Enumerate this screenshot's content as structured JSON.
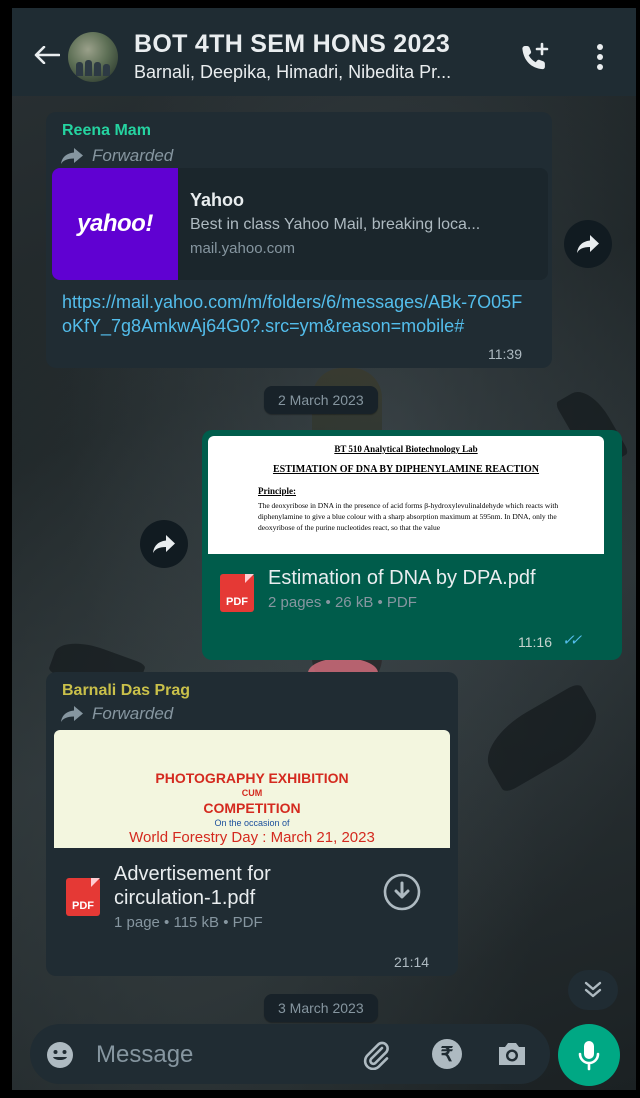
{
  "header": {
    "title": "BOT 4TH SEM HONS 2023",
    "members": "Barnali, Deepika, Himadri, Nibedita Pr..."
  },
  "messages": {
    "m1": {
      "sender": "Reena Mam",
      "sender_color": "#25d3a0",
      "forwarded": "Forwarded",
      "preview_logo": "yahoo!",
      "preview_title": "Yahoo",
      "preview_desc": "Best in class Yahoo Mail, breaking loca...",
      "preview_domain": "mail.yahoo.com",
      "link": "https://mail.yahoo.com/m/folders/6/messages/ABk-7O05FoKfY_7g8AmkwAj64G0?.src=ym&reason=mobile#",
      "time": "11:39"
    },
    "date1": "2 March 2023",
    "m2": {
      "thumb_header": "BT 510 Analytical Biotechnology Lab",
      "thumb_title": "ESTIMATION OF DNA BY DIPHENYLAMINE REACTION",
      "thumb_principle": "Principle:",
      "thumb_body": "The deoxyribose in DNA in the presence of acid forms β-hydroxylevulinaldehyde which reacts with diphenylamine to give a blue colour with a sharp absorption maximum at 595nm. In DNA, only the deoxyribose of the purine nucleotides react, so that the value",
      "file_badge": "PDF",
      "file_name": "Estimation of DNA by DPA.pdf",
      "file_meta": "2 pages • 26 kB • PDF",
      "time": "11:16",
      "read_receipt": "✓✓"
    },
    "m3": {
      "sender": "Barnali Das Prag",
      "sender_color": "#c9c04a",
      "forwarded": "Forwarded",
      "thumb_line1": "PHOTOGRAPHY EXHIBITION",
      "thumb_line2": "CUM",
      "thumb_line3": "COMPETITION",
      "thumb_line4": "On the occasion of",
      "thumb_line5": "World Forestry Day : March 21, 2023",
      "file_badge": "PDF",
      "file_name": "Advertisement for circulation-1.pdf",
      "file_meta": "1 page • 115 kB • PDF",
      "time": "21:14"
    },
    "date2": "3 March 2023"
  },
  "composer": {
    "placeholder": "Message",
    "rupee_symbol": "₹"
  },
  "icons": {
    "back": "back-arrow-icon",
    "call": "add-call-icon",
    "menu": "more-vertical-icon",
    "forward": "forward-icon",
    "download": "download-icon",
    "scroll": "chevron-double-down-icon",
    "emoji": "emoji-icon",
    "attach": "paperclip-icon",
    "camera": "camera-icon",
    "mic": "mic-icon"
  },
  "colors": {
    "header_bg": "#1f2c33",
    "incoming_bubble": "#202c33",
    "outgoing_bubble": "#005c4b",
    "link": "#53bdeb",
    "accent": "#00a884",
    "read_tick": "#53bdeb"
  }
}
